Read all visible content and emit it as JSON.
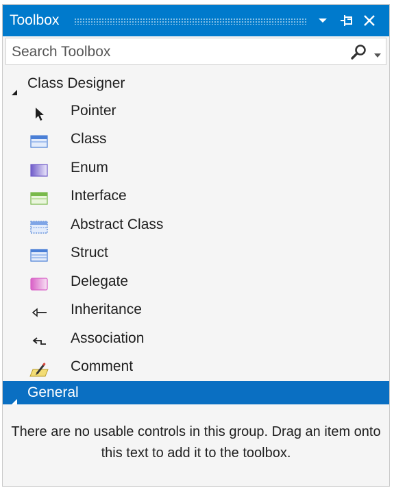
{
  "window": {
    "title": "Toolbox"
  },
  "search": {
    "placeholder": "Search Toolbox"
  },
  "groups": [
    {
      "name": "Class Designer",
      "items": [
        {
          "label": "Pointer",
          "icon": "pointer-icon"
        },
        {
          "label": "Class",
          "icon": "class-icon"
        },
        {
          "label": "Enum",
          "icon": "enum-icon"
        },
        {
          "label": "Interface",
          "icon": "interface-icon"
        },
        {
          "label": "Abstract Class",
          "icon": "abstract-class-icon"
        },
        {
          "label": "Struct",
          "icon": "struct-icon"
        },
        {
          "label": "Delegate",
          "icon": "delegate-icon"
        },
        {
          "label": "Inheritance",
          "icon": "inheritance-icon"
        },
        {
          "label": "Association",
          "icon": "association-icon"
        },
        {
          "label": "Comment",
          "icon": "comment-icon"
        }
      ]
    },
    {
      "name": "General",
      "empty_message": "There are no usable controls in this group. Drag an item onto this text to add it to the toolbox."
    }
  ],
  "colors": {
    "titlebar": "#007acc",
    "selected_group": "#0a6fc2",
    "panel_background": "#f5f5f5"
  }
}
